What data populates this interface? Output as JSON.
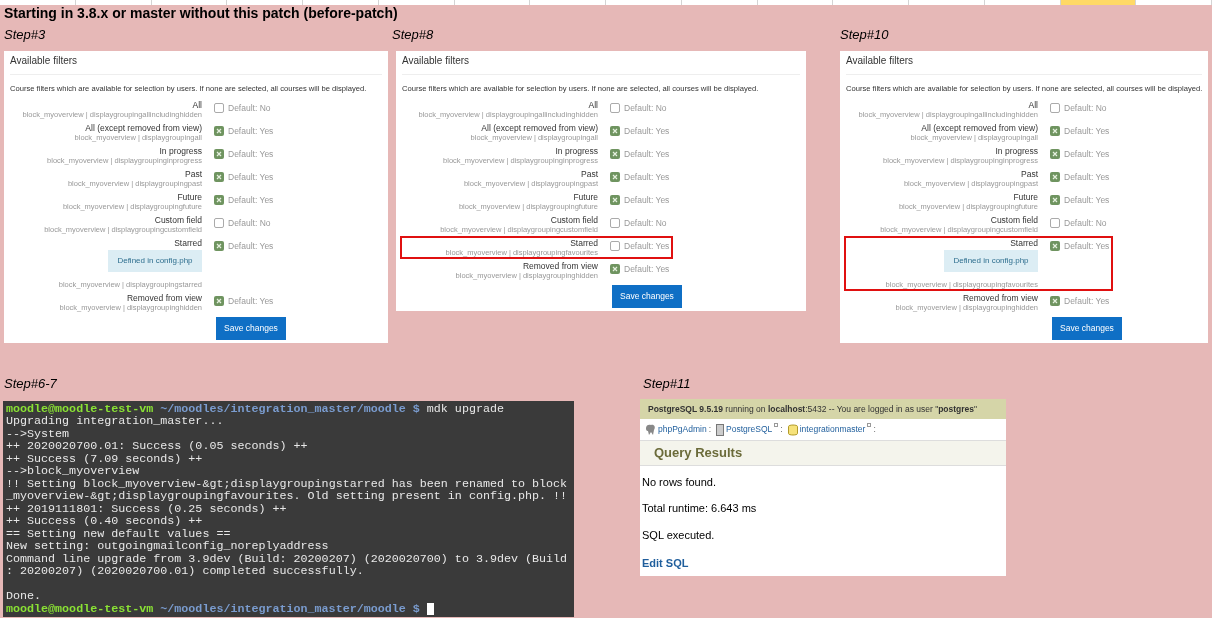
{
  "heading": "Starting in 3.8.x or master without this patch (before-patch)",
  "filter_steps": [
    {
      "label": "Step#3",
      "title": "Available filters",
      "description": "Course filters which are available for selection by users. If none are selected, all courses will be displayed.",
      "filters": [
        {
          "label": "All",
          "setting": "block_myoverview | displaygroupingallincludinghidden",
          "checked": false,
          "default": "Default: No",
          "highlighted": false
        },
        {
          "label": "All (except removed from view)",
          "setting": "block_myoverview | displaygroupingall",
          "checked": true,
          "default": "Default: Yes",
          "highlighted": false
        },
        {
          "label": "In progress",
          "setting": "block_myoverview | displaygroupinginprogress",
          "checked": true,
          "default": "Default: Yes",
          "highlighted": false
        },
        {
          "label": "Past",
          "setting": "block_myoverview | displaygroupingpast",
          "checked": true,
          "default": "Default: Yes",
          "highlighted": false
        },
        {
          "label": "Future",
          "setting": "block_myoverview | displaygroupingfuture",
          "checked": true,
          "default": "Default: Yes",
          "highlighted": false
        },
        {
          "label": "Custom field",
          "setting": "block_myoverview | displaygroupingcustomfield",
          "checked": false,
          "default": "Default: No",
          "highlighted": false
        },
        {
          "label": "Starred",
          "config_note": "Defined in config.php",
          "setting": "block_myoverview | displaygroupingstarred",
          "checked": true,
          "default": "Default: Yes",
          "highlighted": false
        },
        {
          "label": "Removed from view",
          "setting": "block_myoverview | displaygroupinghidden",
          "checked": true,
          "default": "Default: Yes",
          "highlighted": false
        }
      ],
      "button": "Save changes"
    },
    {
      "label": "Step#8",
      "title": "Available filters",
      "description": "Course filters which are available for selection by users. If none are selected, all courses will be displayed.",
      "filters": [
        {
          "label": "All",
          "setting": "block_myoverview | displaygroupingallincludinghidden",
          "checked": false,
          "default": "Default: No",
          "highlighted": false
        },
        {
          "label": "All (except removed from view)",
          "setting": "block_myoverview | displaygroupingall",
          "checked": true,
          "default": "Default: Yes",
          "highlighted": false
        },
        {
          "label": "In progress",
          "setting": "block_myoverview | displaygroupinginprogress",
          "checked": true,
          "default": "Default: Yes",
          "highlighted": false
        },
        {
          "label": "Past",
          "setting": "block_myoverview | displaygroupingpast",
          "checked": true,
          "default": "Default: Yes",
          "highlighted": false
        },
        {
          "label": "Future",
          "setting": "block_myoverview | displaygroupingfuture",
          "checked": true,
          "default": "Default: Yes",
          "highlighted": false
        },
        {
          "label": "Custom field",
          "setting": "block_myoverview | displaygroupingcustomfield",
          "checked": false,
          "default": "Default: No",
          "highlighted": false
        },
        {
          "label": "Starred",
          "setting": "block_myoverview | displaygroupingfavourites",
          "checked": false,
          "default": "Default: Yes",
          "highlighted": true
        },
        {
          "label": "Removed from view",
          "setting": "block_myoverview | displaygroupinghidden",
          "checked": true,
          "default": "Default: Yes",
          "highlighted": false
        }
      ],
      "button": "Save changes"
    },
    {
      "label": "Step#10",
      "title": "Available filters",
      "description": "Course filters which are available for selection by users. If none are selected, all courses will be displayed.",
      "filters": [
        {
          "label": "All",
          "setting": "block_myoverview | displaygroupingallincludinghidden",
          "checked": false,
          "default": "Default: No",
          "highlighted": false
        },
        {
          "label": "All (except removed from view)",
          "setting": "block_myoverview | displaygroupingall",
          "checked": true,
          "default": "Default: Yes",
          "highlighted": false
        },
        {
          "label": "In progress",
          "setting": "block_myoverview | displaygroupinginprogress",
          "checked": true,
          "default": "Default: Yes",
          "highlighted": false
        },
        {
          "label": "Past",
          "setting": "block_myoverview | displaygroupingpast",
          "checked": true,
          "default": "Default: Yes",
          "highlighted": false
        },
        {
          "label": "Future",
          "setting": "block_myoverview | displaygroupingfuture",
          "checked": true,
          "default": "Default: Yes",
          "highlighted": false
        },
        {
          "label": "Custom field",
          "setting": "block_myoverview | displaygroupingcustomfield",
          "checked": false,
          "default": "Default: No",
          "highlighted": false
        },
        {
          "label": "Starred",
          "config_note": "Defined in config.php",
          "setting": "block_myoverview | displaygroupingfavourites",
          "checked": true,
          "default": "Default: Yes",
          "highlighted": true
        },
        {
          "label": "Removed from view",
          "setting": "block_myoverview | displaygroupinghidden",
          "checked": true,
          "default": "Default: Yes",
          "highlighted": false
        }
      ],
      "button": "Save changes"
    }
  ],
  "terminal_step": {
    "label": "Step#6-7",
    "lines": [
      {
        "kind": "prompt",
        "user": "moodle@moodle-test-vm",
        "path": "~/moodles/integration_master/moodle $",
        "command": "mdk upgrade",
        "cursor": false
      },
      {
        "kind": "output",
        "text": "Upgrading integration_master..."
      },
      {
        "kind": "output",
        "text": "-->System"
      },
      {
        "kind": "output",
        "text": "++ 2020020700.01: Success (0.05 seconds) ++"
      },
      {
        "kind": "output",
        "text": "++ Success (7.09 seconds) ++"
      },
      {
        "kind": "output",
        "text": "-->block_myoverview"
      },
      {
        "kind": "output",
        "text": "!! Setting block_myoverview-&gt;displaygroupingstarred has been renamed to block"
      },
      {
        "kind": "output",
        "text": "_myoverview-&gt;displaygroupingfavourites. Old setting present in config.php. !!"
      },
      {
        "kind": "output",
        "text": "++ 2019111801: Success (0.25 seconds) ++"
      },
      {
        "kind": "output",
        "text": "++ Success (0.40 seconds) ++"
      },
      {
        "kind": "output",
        "text": "== Setting new default values =="
      },
      {
        "kind": "output",
        "text": "New setting: outgoingmailconfig_noreplyaddress"
      },
      {
        "kind": "output",
        "text": "Command line upgrade from 3.9dev (Build: 20200207) (2020020700) to 3.9dev (Build"
      },
      {
        "kind": "output",
        "text": ": 20200207) (2020020700.01) completed successfully."
      },
      {
        "kind": "blank"
      },
      {
        "kind": "output",
        "text": "Done."
      },
      {
        "kind": "prompt",
        "user": "moodle@moodle-test-vm",
        "path": "~/moodles/integration_master/moodle $",
        "cursor": true
      }
    ]
  },
  "db_step": {
    "label": "Step#11",
    "server_info": "**PostgreSQL 9.5.19** running on **localhost**:5432 -- You are logged in as user \"**postgres**\"",
    "separator": ":",
    "breadcrumb": [
      {
        "label": "phpPgAdmin",
        "popup": false
      },
      {
        "label": "PostgreSQL",
        "popup": true
      },
      {
        "label": "integrationmaster",
        "popup": true
      }
    ],
    "section_title": "Query Results",
    "messages": [
      "No rows found.",
      "Total runtime: 6.643 ms",
      "SQL executed."
    ],
    "link": "Edit SQL"
  }
}
